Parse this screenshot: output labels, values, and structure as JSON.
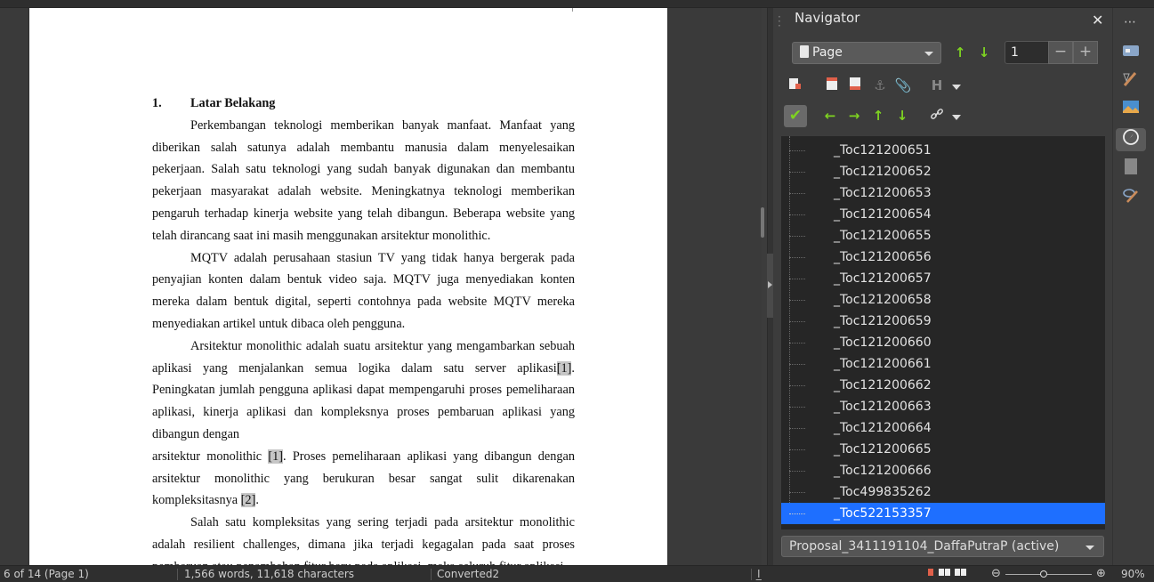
{
  "document": {
    "heading_number": "1.",
    "heading_title": "Latar Belakang",
    "paragraphs": [
      {
        "text": "Perkembangan teknologi memberikan banyak manfaat. Manfaat yang diberikan salah satunya adalah membantu manusia dalam menyelesaikan pekerjaan. Salah satu teknologi yang sudah banyak digunakan dan membantu pekerjaan masyarakat adalah website. Meningkatnya teknologi memberikan pengaruh terhadap kinerja website yang telah dibangun. Beberapa website yang telah dirancang saat ini masih menggunakan arsitektur monolithic."
      },
      {
        "text": "MQTV adalah perusahaan stasiun TV yang tidak hanya bergerak pada penyajian konten dalam bentuk video saja. MQTV juga menyediakan konten mereka dalam bentuk digital, seperti contohnya pada website MQTV mereka menyediakan artikel untuk dibaca oleh pengguna."
      },
      {
        "pre": "Arsitektur monolithic adalah suatu arsitektur yang mengambarkan sebuah aplikasi yang menjalankan semua logika dalam satu server aplikasi",
        "cite": "[1]",
        "post": ". Peningkatan jumlah pengguna aplikasi dapat mempengaruhi proses pemeliharaan aplikasi, kinerja aplikasi dan kompleksnya proses pembaruan aplikasi yang dibangun dengan"
      },
      {
        "pre": "arsitektur monolithic ",
        "cite": "[1]",
        "post": ". Proses pemeliharaan aplikasi yang dibangun dengan arsitektur monolithic yang berukuran besar sangat sulit dikarenakan kompleksitasnya ",
        "cite2": "[2]",
        "post2": "."
      },
      {
        "text": "Salah satu kompleksitas yang sering terjadi pada arsitektur monolithic adalah resilient challenges, dimana jika terjadi kegagalan pada saat proses pembaruan atau penambahan fitur baru pada aplikasi, maka seluruh fitur aplikasi"
      }
    ]
  },
  "navigator": {
    "title": "Navigator",
    "close_label": "✕",
    "category_select": "Page",
    "page_number": "1",
    "minus_label": "−",
    "plus_label": "+",
    "tree_items": [
      "_Toc121200651",
      "_Toc121200652",
      "_Toc121200653",
      "_Toc121200654",
      "_Toc121200655",
      "_Toc121200656",
      "_Toc121200657",
      "_Toc121200658",
      "_Toc121200659",
      "_Toc121200660",
      "_Toc121200661",
      "_Toc121200662",
      "_Toc121200663",
      "_Toc121200664",
      "_Toc121200665",
      "_Toc121200666",
      "_Toc499835262",
      "_Toc522153357"
    ],
    "selected_index": 17,
    "document_select": "Proposal_3411191104_DaffaPutraP (active)"
  },
  "sidebar": {
    "menu_label": "⋯",
    "buttons": [
      "properties-icon",
      "styles-icon",
      "gallery-icon",
      "navigator-icon",
      "page-icon",
      "manage-changes-icon"
    ],
    "active": "navigator-icon"
  },
  "status": {
    "page": "6 of 14 (Page 1)",
    "words": "1,566 words, 11,618 characters",
    "style": "Converted2",
    "zoom": "90%",
    "zoom_fraction": 0.42
  },
  "colors": {
    "accent": "#1e6fff",
    "green_arrow": "#7ed321"
  }
}
